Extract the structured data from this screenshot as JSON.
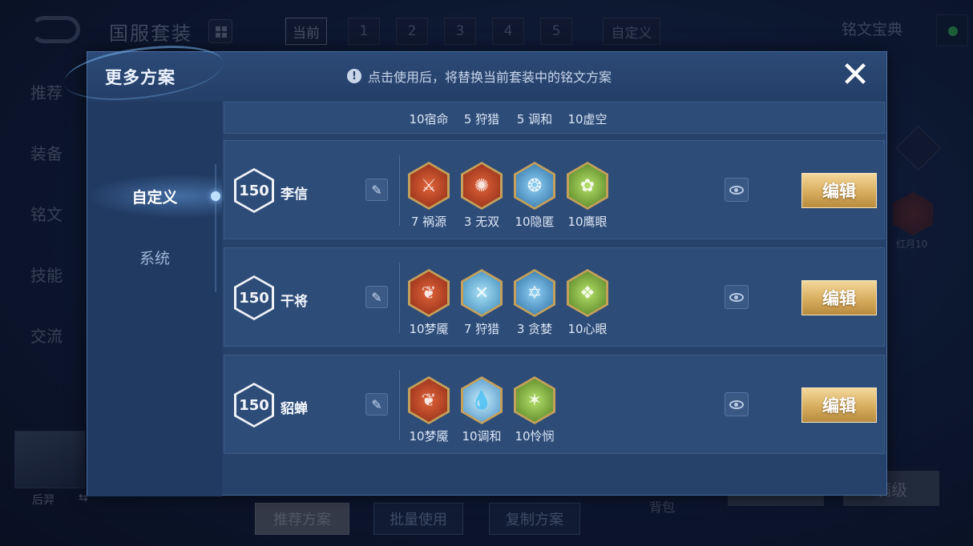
{
  "background": {
    "title": "国服套装",
    "tabs": [
      "当前",
      "1",
      "2",
      "3",
      "4",
      "5",
      "自定义"
    ],
    "rune_book": "铭文宝典",
    "left_nav": [
      "推荐",
      "装备",
      "铭文",
      "技能",
      "交流"
    ],
    "hero_name": "后羿",
    "right_badge": "红月10",
    "bag": "背包",
    "max_level": "满级",
    "bottom_buttons": [
      "推荐方案",
      "批量使用",
      "复制方案"
    ]
  },
  "modal": {
    "title": "更多方案",
    "notice": "点击使用后，将替换当前套装中的铭文方案",
    "close": "✕",
    "side_tabs": [
      "自定义",
      "系统"
    ],
    "partial_row": {
      "runes": [
        "10宿命",
        "5 狩猎",
        "5 调和",
        "10虚空"
      ]
    },
    "plans": [
      {
        "level": "150",
        "name": "李信",
        "runes": [
          "7 祸源",
          "3 无双",
          "10隐匿",
          "10鹰眼"
        ],
        "edit": "编辑"
      },
      {
        "level": "150",
        "name": "干将",
        "runes": [
          "10梦魇",
          "7 狩猎",
          "3 贪婪",
          "10心眼"
        ],
        "edit": "编辑"
      },
      {
        "level": "150",
        "name": "貂蝉",
        "runes": [
          "10梦魇",
          "10调和",
          "10怜悯"
        ],
        "edit": "编辑"
      }
    ]
  },
  "colors": {
    "red_rune": "#c8471e",
    "blue_rune": "#4b8fc4",
    "green_rune": "#6c9c2e",
    "edit_gold": "#d7ad5e"
  }
}
